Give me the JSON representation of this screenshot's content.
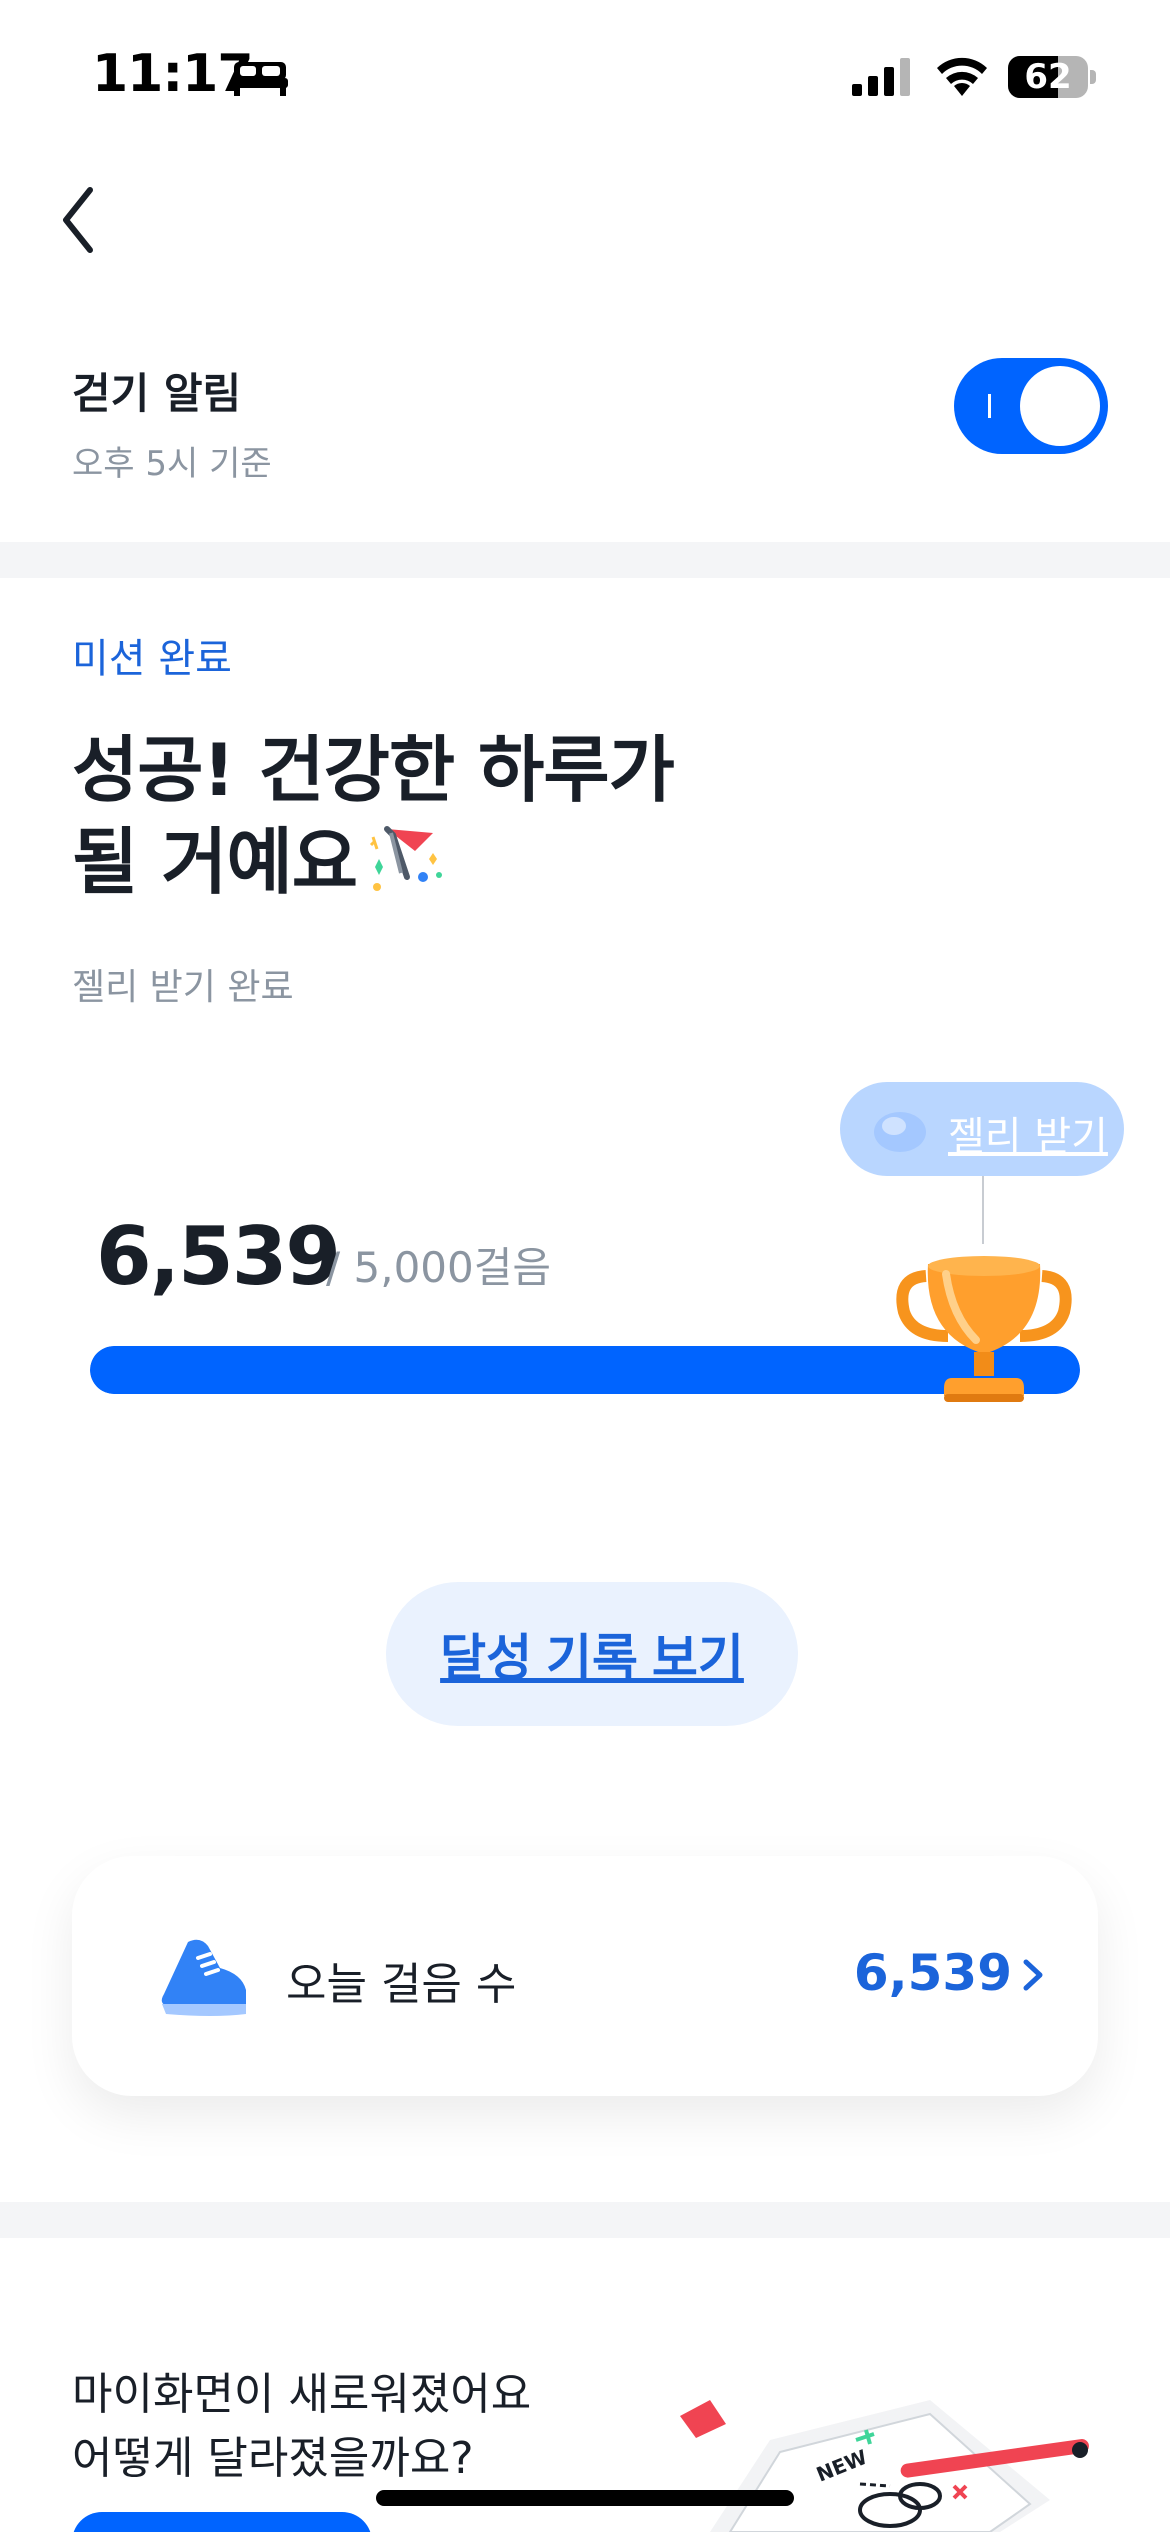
{
  "status_bar": {
    "time": "11:17",
    "battery": "62",
    "battery_level": 0.62
  },
  "alarm": {
    "title": "걷기 알림",
    "subtitle": "오후 5시 기준",
    "enabled": true
  },
  "mission": {
    "label": "미션 완료",
    "headline_line1": "성공! 건강한 하루가",
    "headline_line2": "될 거예요",
    "subtitle": "젤리 받기 완료"
  },
  "progress": {
    "jelly_chip_label": "젤리 받기",
    "steps": "6,539",
    "goal": "/ 5,000걸음",
    "fraction": 1.0
  },
  "record_button": {
    "label": "달성 기록 보기"
  },
  "steps_card": {
    "label": "오늘 걸음 수",
    "value": "6,539"
  },
  "banner": {
    "line1": "마이화면이 새로워졌어요",
    "line2": "어떻게 달라졌을까요?",
    "art_text": "NEW"
  },
  "colors": {
    "accent": "#0064ff",
    "accent_text": "#1b64da",
    "secondary_text": "#8b95a1",
    "divider": "#f4f5f7"
  },
  "icons": [
    "bed-icon",
    "signal-icon",
    "wifi-icon",
    "back-arrow-icon",
    "party-popper-icon",
    "jelly-icon",
    "trophy-icon",
    "shoe-icon",
    "chevron-right-icon"
  ]
}
